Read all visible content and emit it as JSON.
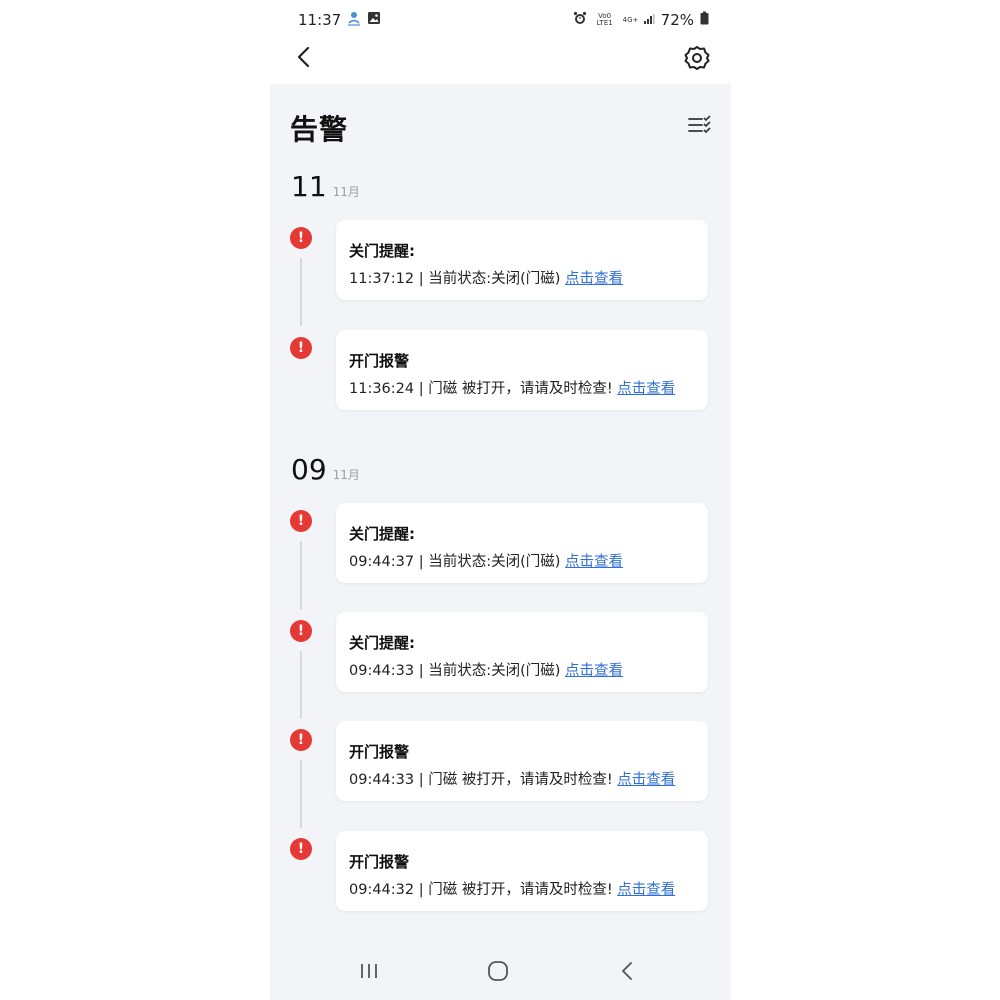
{
  "status_bar": {
    "time": "11:37",
    "net_top": "Vo0 LTE1",
    "net_gen": "4G+",
    "battery": "72%"
  },
  "header": {
    "title": "告警"
  },
  "groups": [
    {
      "day": "11",
      "month": "11月",
      "alerts": [
        {
          "title": "关门提醒:",
          "detail": "11:37:12 | 当前状态:关闭(门磁) ",
          "link": "点击查看"
        },
        {
          "title": "开门报警",
          "detail": "11:36:24 | 门磁 被打开，请请及时检查!  ",
          "link": "点击查看"
        }
      ]
    },
    {
      "day": "09",
      "month": "11月",
      "alerts": [
        {
          "title": "关门提醒:",
          "detail": "09:44:37 | 当前状态:关闭(门磁) ",
          "link": "点击查看"
        },
        {
          "title": "关门提醒:",
          "detail": "09:44:33 | 当前状态:关闭(门磁) ",
          "link": "点击查看"
        },
        {
          "title": "开门报警",
          "detail": "09:44:33 | 门磁 被打开，请请及时检查!  ",
          "link": "点击查看"
        },
        {
          "title": "开门报警",
          "detail": "09:44:32 | 门磁 被打开，请请及时检查!  ",
          "link": "点击查看"
        }
      ]
    }
  ],
  "alert_mark": "!",
  "icons": {
    "back": "back-arrow-icon",
    "settings": "gear-icon",
    "filter": "filter-list-icon",
    "nav_recents": "recents-icon",
    "nav_home": "home-icon",
    "nav_back": "nav-back-icon"
  },
  "colors": {
    "alert": "#e53935",
    "link": "#2f6fd6",
    "background": "#f3f4f8",
    "card": "#ffffff"
  }
}
